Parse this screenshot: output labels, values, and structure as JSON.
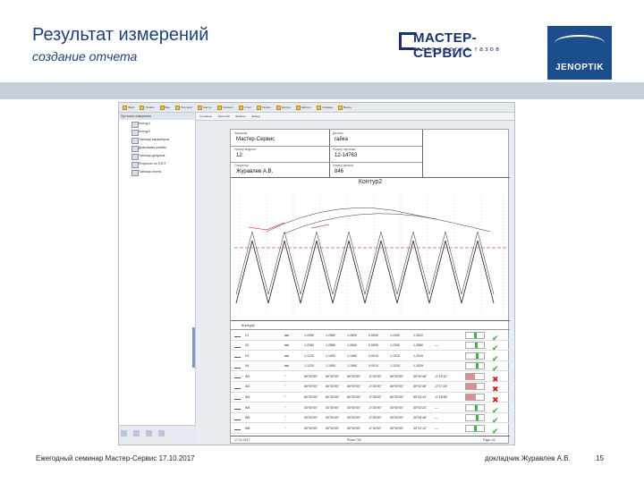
{
  "slide": {
    "title": "Результат измерений",
    "subtitle": "создание отчета"
  },
  "brand": {
    "name": "МАСТЕР-СЕРВИС",
    "tagline": "метрология газов",
    "partner": "JENOPTIK",
    "accent": "#1c4d8c",
    "band_color": "#c7cfdb"
  },
  "app": {
    "toolbar": [
      "Файл",
      "Правка",
      "Вид",
      "Протокол",
      "Контур",
      "Элемент",
      "Отчет",
      "Печать",
      "Допуск",
      "Экспорт",
      "Справка",
      "Выход"
    ],
    "toolbar2": [
      "Страница",
      "Масштаб",
      "Шаблон",
      "Вывод"
    ],
    "tree": {
      "header": "Протокол измерения",
      "items": [
        "Контур1",
        "Контур2",
        "Таблица параметров",
        "Диаграмма резьбы",
        "Таблица допусков",
        "Результат по ГОСТ",
        "Таблица отчета"
      ]
    },
    "doc_header": {
      "labels": [
        "Заказчик",
        "Деталь",
        "Номер модели",
        "Номер чертежа",
        "Оператор",
        "Номер детали"
      ],
      "values": [
        "Мастер-Сервис",
        "гайка",
        "12",
        "12-14763",
        "Журавлев А.В.",
        "846"
      ]
    },
    "chart_title": "Контур2",
    "table": {
      "title": "Контур2",
      "rows": [
        {
          "name": "X1",
          "unit": "мм",
          "v1": "1,2260",
          "v2": "1,2580",
          "v3": "1,2600",
          "v4": "0,0000",
          "v5": "1,2300",
          "v6": "1,2522",
          "v7": "",
          "fill": 0.5,
          "ok": true
        },
        {
          "name": "X2",
          "unit": "мм",
          "v1": "1,2260",
          "v2": "1,2580",
          "v3": "1,2600",
          "v4": "0,0000",
          "v5": "1,2300",
          "v6": "1,2560",
          "v7": "—",
          "fill": 0.55,
          "ok": true
        },
        {
          "name": "X3",
          "unit": "мм",
          "v1": "1,1220",
          "v2": "1,1500",
          "v3": "1,1560",
          "v4": "0,0010",
          "v5": "1,1310",
          "v6": "1,1519",
          "v7": "",
          "fill": 0.6,
          "ok": true
        },
        {
          "name": "X4",
          "unit": "мм",
          "v1": "1,1220",
          "v2": "1,1500",
          "v3": "1,1560",
          "v4": "0,0010",
          "v5": "1,1310",
          "v6": "1,1529",
          "v7": "",
          "fill": 0.62,
          "ok": true
        },
        {
          "name": "W1",
          "unit": "°",
          "v1": "60°00'00\"",
          "v2": "60°30'00\"",
          "v3": "60°00'00\"",
          "v4": "-0°30'00\"",
          "v5": "60°00'00\"",
          "v6": "59°40'48\"",
          "v7": "-0°19'12\"",
          "fill": 0.25,
          "ok": false
        },
        {
          "name": "W2",
          "unit": "°",
          "v1": "60°00'00\"",
          "v2": "60°30'00\"",
          "v3": "60°00'00\"",
          "v4": "-0°30'00\"",
          "v5": "60°00'00\"",
          "v6": "59°42'36\"",
          "v7": "-0°17'24\"",
          "fill": 0.3,
          "ok": false
        },
        {
          "name": "W3",
          "unit": "°",
          "v1": "60°00'00\"",
          "v2": "60°30'00\"",
          "v3": "60°00'00\"",
          "v4": "-0°30'00\"",
          "v5": "60°00'00\"",
          "v6": "59°41'24\"",
          "v7": "-0°18'36\"",
          "fill": 0.28,
          "ok": false
        },
        {
          "name": "W4",
          "unit": "°",
          "v1": "30°00'00\"",
          "v2": "30°30'00\"",
          "v3": "30°00'00\"",
          "v4": "-0°30'00\"",
          "v5": "30°00'00\"",
          "v6": "30°02'24\"",
          "v7": "—",
          "fill": 0.55,
          "ok": true
        },
        {
          "name": "W5",
          "unit": "°",
          "v1": "30°00'00\"",
          "v2": "30°30'00\"",
          "v3": "30°00'00\"",
          "v4": "-0°30'00\"",
          "v5": "30°00'00\"",
          "v6": "30°04'48\"",
          "v7": "—",
          "fill": 0.58,
          "ok": true
        },
        {
          "name": "W6",
          "unit": "°",
          "v1": "30°00'00\"",
          "v2": "30°30'00\"",
          "v3": "30°00'00\"",
          "v4": "-0°30'00\"",
          "v5": "30°00'00\"",
          "v6": "30°01'12\"",
          "v7": "—",
          "fill": 0.52,
          "ok": true
        }
      ]
    },
    "page_footer": {
      "left": "17.10.2017",
      "mid": "Prism 700",
      "right": "Page 1/2"
    },
    "colors": {
      "ok": "#2eaa2e",
      "bad": "#d12020",
      "ok_fill": "#39b54a",
      "bad_fill": "#d9918f"
    }
  },
  "footer": {
    "left": "Ежегодный семинар Мастер-Сервис 17.10.2017",
    "mid": "докладчик Журавлев А.В.",
    "page": "15"
  }
}
